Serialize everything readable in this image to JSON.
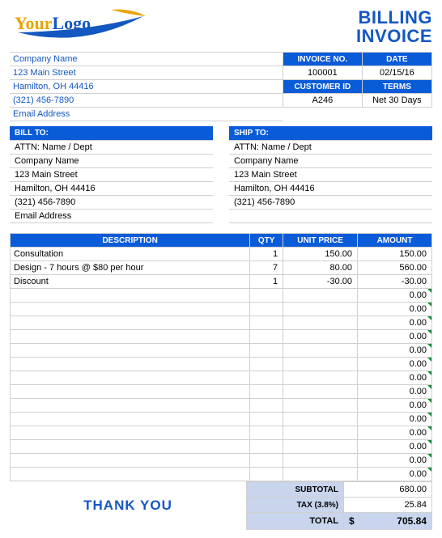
{
  "title_line1": "BILLING",
  "title_line2": "INVOICE",
  "logo": {
    "your": "Your",
    "logo": "Logo"
  },
  "company": {
    "name": "Company Name",
    "street": "123 Main Street",
    "city": "Hamilton, OH  44416",
    "phone": "(321) 456-7890",
    "email": "Email Address"
  },
  "meta": {
    "headers": {
      "invoice": "INVOICE NO.",
      "date": "DATE",
      "customer": "CUSTOMER ID",
      "terms": "TERMS"
    },
    "invoice_no": "100001",
    "date": "02/15/16",
    "customer_id": "A246",
    "terms": "Net 30 Days"
  },
  "billto": {
    "header": "BILL TO:",
    "attn": "ATTN: Name / Dept",
    "company": "Company Name",
    "street": "123 Main Street",
    "city": "Hamilton, OH  44416",
    "phone": "(321) 456-7890",
    "email": "Email Address"
  },
  "shipto": {
    "header": "SHIP TO:",
    "attn": "ATTN: Name / Dept",
    "company": "Company Name",
    "street": "123 Main Street",
    "city": "Hamilton, OH  44416",
    "phone": "(321) 456-7890"
  },
  "items_headers": {
    "desc": "DESCRIPTION",
    "qty": "QTY",
    "price": "UNIT PRICE",
    "amount": "AMOUNT"
  },
  "items": [
    {
      "desc": "Consultation",
      "qty": "1",
      "price": "150.00",
      "amount": "150.00"
    },
    {
      "desc": "Design - 7 hours @ $80 per hour",
      "qty": "7",
      "price": "80.00",
      "amount": "560.00"
    },
    {
      "desc": "Discount",
      "qty": "1",
      "price": "-30.00",
      "amount": "-30.00"
    },
    {
      "desc": "",
      "qty": "",
      "price": "",
      "amount": "0.00"
    },
    {
      "desc": "",
      "qty": "",
      "price": "",
      "amount": "0.00"
    },
    {
      "desc": "",
      "qty": "",
      "price": "",
      "amount": "0.00"
    },
    {
      "desc": "",
      "qty": "",
      "price": "",
      "amount": "0.00"
    },
    {
      "desc": "",
      "qty": "",
      "price": "",
      "amount": "0.00"
    },
    {
      "desc": "",
      "qty": "",
      "price": "",
      "amount": "0.00"
    },
    {
      "desc": "",
      "qty": "",
      "price": "",
      "amount": "0.00"
    },
    {
      "desc": "",
      "qty": "",
      "price": "",
      "amount": "0.00"
    },
    {
      "desc": "",
      "qty": "",
      "price": "",
      "amount": "0.00"
    },
    {
      "desc": "",
      "qty": "",
      "price": "",
      "amount": "0.00"
    },
    {
      "desc": "",
      "qty": "",
      "price": "",
      "amount": "0.00"
    },
    {
      "desc": "",
      "qty": "",
      "price": "",
      "amount": "0.00"
    },
    {
      "desc": "",
      "qty": "",
      "price": "",
      "amount": "0.00"
    },
    {
      "desc": "",
      "qty": "",
      "price": "",
      "amount": "0.00"
    }
  ],
  "totals": {
    "subtotal_label": "SUBTOTAL",
    "subtotal": "680.00",
    "tax_label": "TAX (3.8%)",
    "tax": "25.84",
    "total_label": "TOTAL",
    "total": "705.84",
    "currency": "$"
  },
  "thanks": "THANK YOU"
}
